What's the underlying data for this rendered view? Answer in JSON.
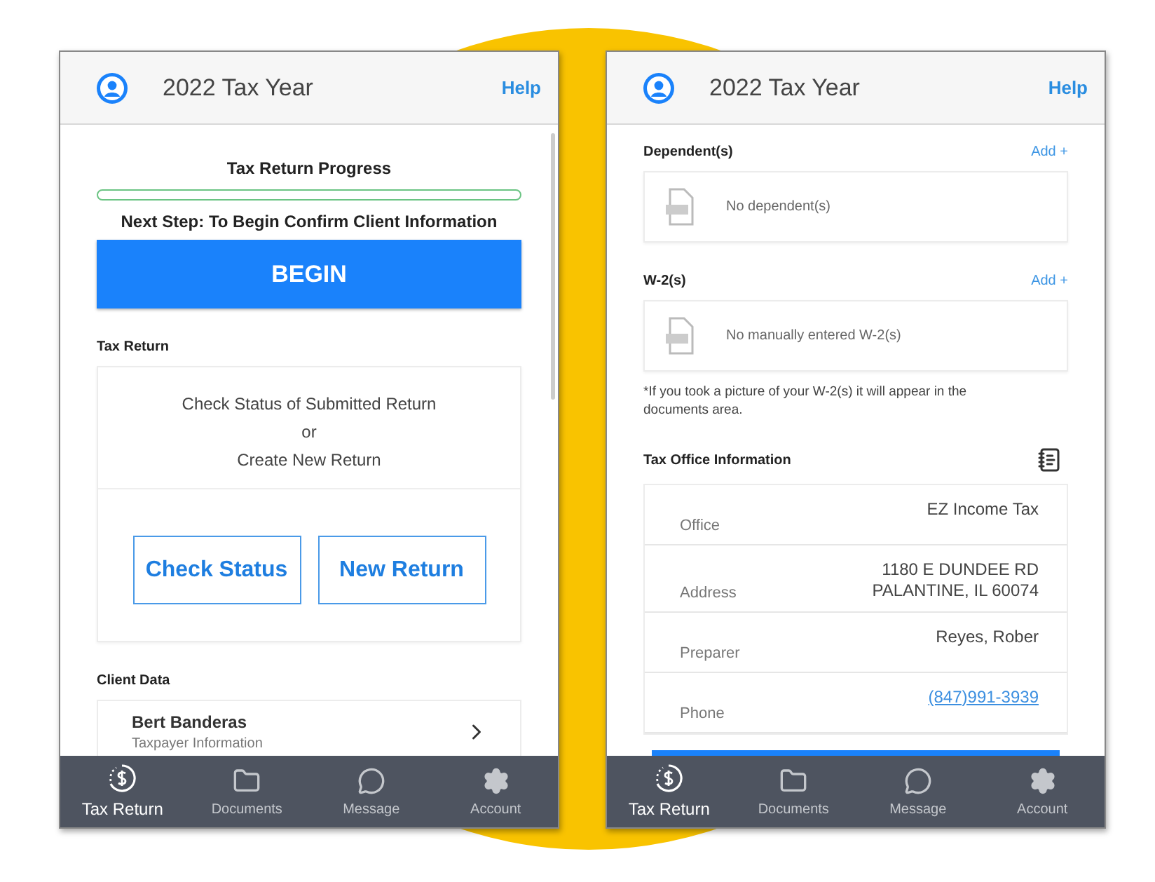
{
  "left_screen": {
    "header": {
      "title": "2022 Tax Year",
      "help": "Help"
    },
    "progress": {
      "title": "Tax Return Progress",
      "level": 0,
      "next_step": "Next Step: To Begin Confirm Client Information",
      "button": "BEGIN"
    },
    "tax_return": {
      "heading": "Tax Return",
      "lines": [
        "Check Status of Submitted Return",
        "or",
        "Create New Return"
      ],
      "buttons": [
        "Check Status",
        "New Return"
      ]
    },
    "client_data": {
      "heading": "Client Data",
      "items": [
        {
          "name": "Bert Banderas",
          "role": "Taxpayer Information"
        }
      ]
    },
    "tabs": [
      {
        "label": "Tax Return",
        "selected": true
      },
      {
        "label": "Documents",
        "selected": false
      },
      {
        "label": "Message",
        "selected": false
      },
      {
        "label": "Account",
        "selected": false
      }
    ]
  },
  "right_screen": {
    "header": {
      "title": "2022 Tax Year",
      "help": "Help"
    },
    "sections": [
      {
        "heading": "Dependent(s)",
        "action": "Add +",
        "empty_text": "No dependent(s)"
      },
      {
        "heading": "W-2(s)",
        "action": "Add +",
        "empty_text": "No manually entered W-2(s)"
      }
    ],
    "note": "*If you took a picture of your W-2(s) it will appear in the documents area.",
    "tax_office": {
      "heading": "Tax Office Information",
      "rows": [
        {
          "label": "Office",
          "kind": "text",
          "value": [
            "EZ Income Tax"
          ]
        },
        {
          "label": "Address",
          "kind": "text",
          "value": [
            "1180 E DUNDEE RD",
            "PALANTINE, IL 60074"
          ]
        },
        {
          "label": "Preparer",
          "kind": "text",
          "value": [
            "Reyes, Rober"
          ]
        },
        {
          "label": "Phone",
          "kind": "link",
          "value": [
            "(847)991-3939"
          ]
        }
      ]
    },
    "tabs": [
      {
        "label": "Tax Return",
        "selected": true
      },
      {
        "label": "Documents",
        "selected": false
      },
      {
        "label": "Message",
        "selected": false
      },
      {
        "label": "Account",
        "selected": false
      }
    ]
  }
}
